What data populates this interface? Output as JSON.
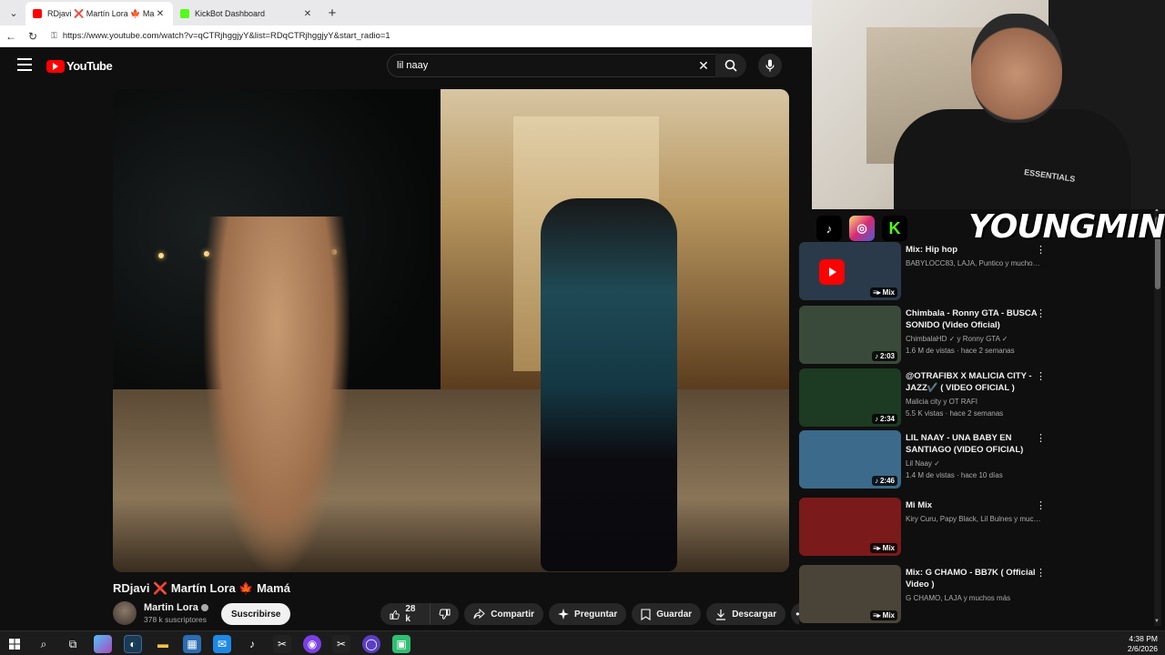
{
  "browser": {
    "tabs": [
      {
        "title": "RDjavi ❌ Martín Lora 🍁 Mamá - YouTube",
        "active": true
      },
      {
        "title": "KickBot Dashboard",
        "active": false
      }
    ],
    "url": "https://www.youtube.com/watch?v=qCTRjhggjyY&list=RDqCTRjhggjyY&start_radio=1"
  },
  "youtube": {
    "logo": "YouTube",
    "search_value": "lil naay",
    "video": {
      "title_a": "RDjavi",
      "title_x": "❌",
      "title_b": "Martín Lora 🍁 Mamá",
      "channel_name": "Martin Lora",
      "subscribers": "378 k suscriptores",
      "subscribe_label": "Suscribirse",
      "likes": "28 k",
      "share_label": "Compartir",
      "ask_label": "Preguntar",
      "save_label": "Guardar",
      "download_label": "Descargar"
    },
    "recommendations": [
      {
        "title": "Mix: Hip hop",
        "meta1": "BABYLOCC83, LAJA, Puntico y muchos ...",
        "meta2": "",
        "badge": "Mix",
        "color": "#2a3a4a"
      },
      {
        "title": "Chimbala - Ronny GTA - BUSCA SONIDO (Video Oficial)",
        "meta1": "ChimbalaHD ✓ y Ronny GTA ✓",
        "meta2": "1.6 M de vistas · hace 2 semanas",
        "badge": "2:03",
        "color": "#3a4a3a"
      },
      {
        "title": "@OTRAFIBX X MALICIA CITY - JAZZ✔️ ( VIDEO OFICIAL )",
        "meta1": "Malicia city y OT RAFI",
        "meta2": "5.5 K vistas · hace 2 semanas",
        "badge": "2:34",
        "color": "#1d3a22"
      },
      {
        "title": "LIL NAAY - UNA BABY EN SANTIAGO (VIDEO OFICIAL)",
        "meta1": "Lil Naay ✓",
        "meta2": "1.4 M de vistas · hace 10 días",
        "badge": "2:46",
        "color": "#3b6a8a"
      },
      {
        "title": "Mi Mix",
        "meta1": "Kiry Curu, Papy Black, Lil Bulnes y mucho...",
        "meta2": "",
        "badge": "Mix",
        "color": "#7a1a1a"
      },
      {
        "title": "Mix: G CHAMO - BB7K ( Official Video )",
        "meta1": "G CHAMO, LAJA y muchos más",
        "meta2": "",
        "badge": "Mix",
        "color": "#4a4438"
      }
    ]
  },
  "overlay": {
    "streamer_name": "YOUNGMINOR",
    "hoodie_text": "ESSENTIALS"
  },
  "taskbar": {
    "time": "4:38 PM",
    "date": "2/6/2026"
  },
  "colors": {
    "yt_red": "#ff0000",
    "bg": "#0f0f0f",
    "kick_green": "#53fc18"
  }
}
